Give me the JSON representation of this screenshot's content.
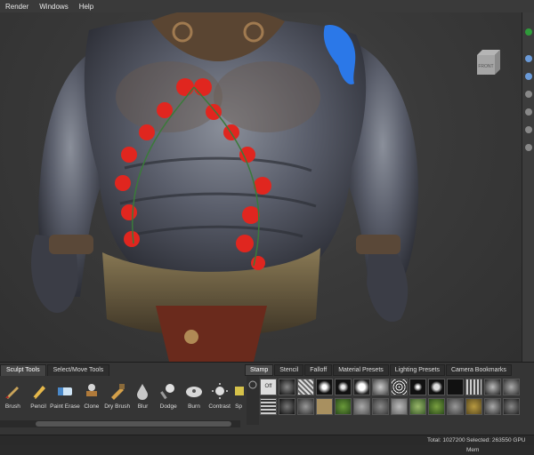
{
  "menu": [
    "Render",
    "Windows",
    "Help"
  ],
  "viewcube": {
    "label": "FRONT"
  },
  "tool_tabs": [
    "Sculpt Tools",
    "Select/Move Tools"
  ],
  "tools": [
    {
      "label": "Brush",
      "icon": "brush-icon"
    },
    {
      "label": "Pencil",
      "icon": "pencil-icon"
    },
    {
      "label": "Paint Erase",
      "icon": "eraser-icon"
    },
    {
      "label": "Clone",
      "icon": "clone-stamp-icon"
    },
    {
      "label": "Dry Brush",
      "icon": "dry-brush-icon"
    },
    {
      "label": "Blur",
      "icon": "blur-drop-icon"
    },
    {
      "label": "Dodge",
      "icon": "dodge-icon"
    },
    {
      "label": "Burn",
      "icon": "burn-icon"
    },
    {
      "label": "Contrast",
      "icon": "contrast-icon"
    },
    {
      "label": "Sp",
      "icon": "sponge-icon"
    }
  ],
  "stamp_tabs": [
    "Stamp",
    "Stencil",
    "Falloff",
    "Material Presets",
    "Lighting Presets",
    "Camera Bookmarks"
  ],
  "stamp_off_label": "Off",
  "status": {
    "total": "Total: 1027200",
    "selected": "Selected: 263550 GPU Mem"
  },
  "colors": {
    "accent_red": "#e0261f",
    "accent_blue": "#2b78e8",
    "panel": "#353535"
  }
}
